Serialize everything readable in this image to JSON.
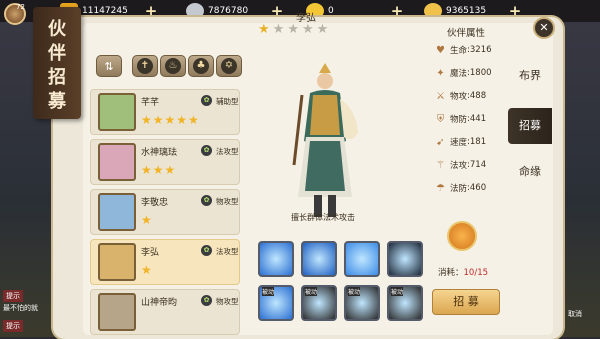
{
  "topbar": {
    "level": "72",
    "resources": [
      {
        "icon": "gold-coin-icon",
        "value": "11147245",
        "color": "#e6a21d"
      },
      {
        "icon": "silver-icon",
        "value": "7876780",
        "color": "#c4c8cf"
      },
      {
        "icon": "yuanbao-icon",
        "value": "0",
        "color": "#f3c636"
      },
      {
        "icon": "gold-ingot-icon",
        "value": "9365135",
        "color": "#f1c24a"
      }
    ]
  },
  "banner": {
    "title": "伙伴招募"
  },
  "partners": [
    {
      "name": "芊芊",
      "type": "辅助型",
      "stars": 5,
      "badge": "2",
      "bg": "#9fbf7a"
    },
    {
      "name": "水神璃珐",
      "type": "法攻型",
      "stars": 3,
      "bg": "#d9a7b8"
    },
    {
      "name": "李敬忠",
      "type": "物攻型",
      "stars": 1,
      "bg": "#8fb7d9"
    },
    {
      "name": "李弘",
      "type": "法攻型",
      "stars": 1,
      "bg": "#d9b36b"
    },
    {
      "name": "山神帝昀",
      "type": "物攻型",
      "stars": 0,
      "bg": "#b7a58a"
    }
  ],
  "hero": {
    "name": "李弘",
    "filled_stars": 1,
    "total_stars": 5,
    "description": "擅长群体法术攻击"
  },
  "skills": [
    {
      "label": ""
    },
    {
      "label": ""
    },
    {
      "label": ""
    },
    {
      "label": ""
    },
    {
      "label": "被动"
    },
    {
      "label": "被动"
    },
    {
      "label": "被动"
    },
    {
      "label": "被动"
    }
  ],
  "attributes": {
    "title": "伙伴属性",
    "items": [
      {
        "icon": "heart-icon",
        "label": "生命",
        "value": "3216"
      },
      {
        "icon": "magic-icon",
        "label": "魔法",
        "value": "1800"
      },
      {
        "icon": "sword-icon",
        "label": "物攻",
        "value": "488"
      },
      {
        "icon": "shield-icon",
        "label": "物防",
        "value": "441"
      },
      {
        "icon": "boot-icon",
        "label": "速度",
        "value": "181"
      },
      {
        "icon": "staff-icon",
        "label": "法攻",
        "value": "714"
      },
      {
        "icon": "cloak-icon",
        "label": "法防",
        "value": "460"
      }
    ]
  },
  "tabs": [
    {
      "label": "布界"
    },
    {
      "label": "招募"
    },
    {
      "label": "命缘"
    }
  ],
  "cost": {
    "label": "消耗：",
    "value": "10/15"
  },
  "recruit_label": "招 募",
  "side": {
    "left1": "提示",
    "left2": "最不怕的就",
    "left3": "提示",
    "right": "取消"
  }
}
